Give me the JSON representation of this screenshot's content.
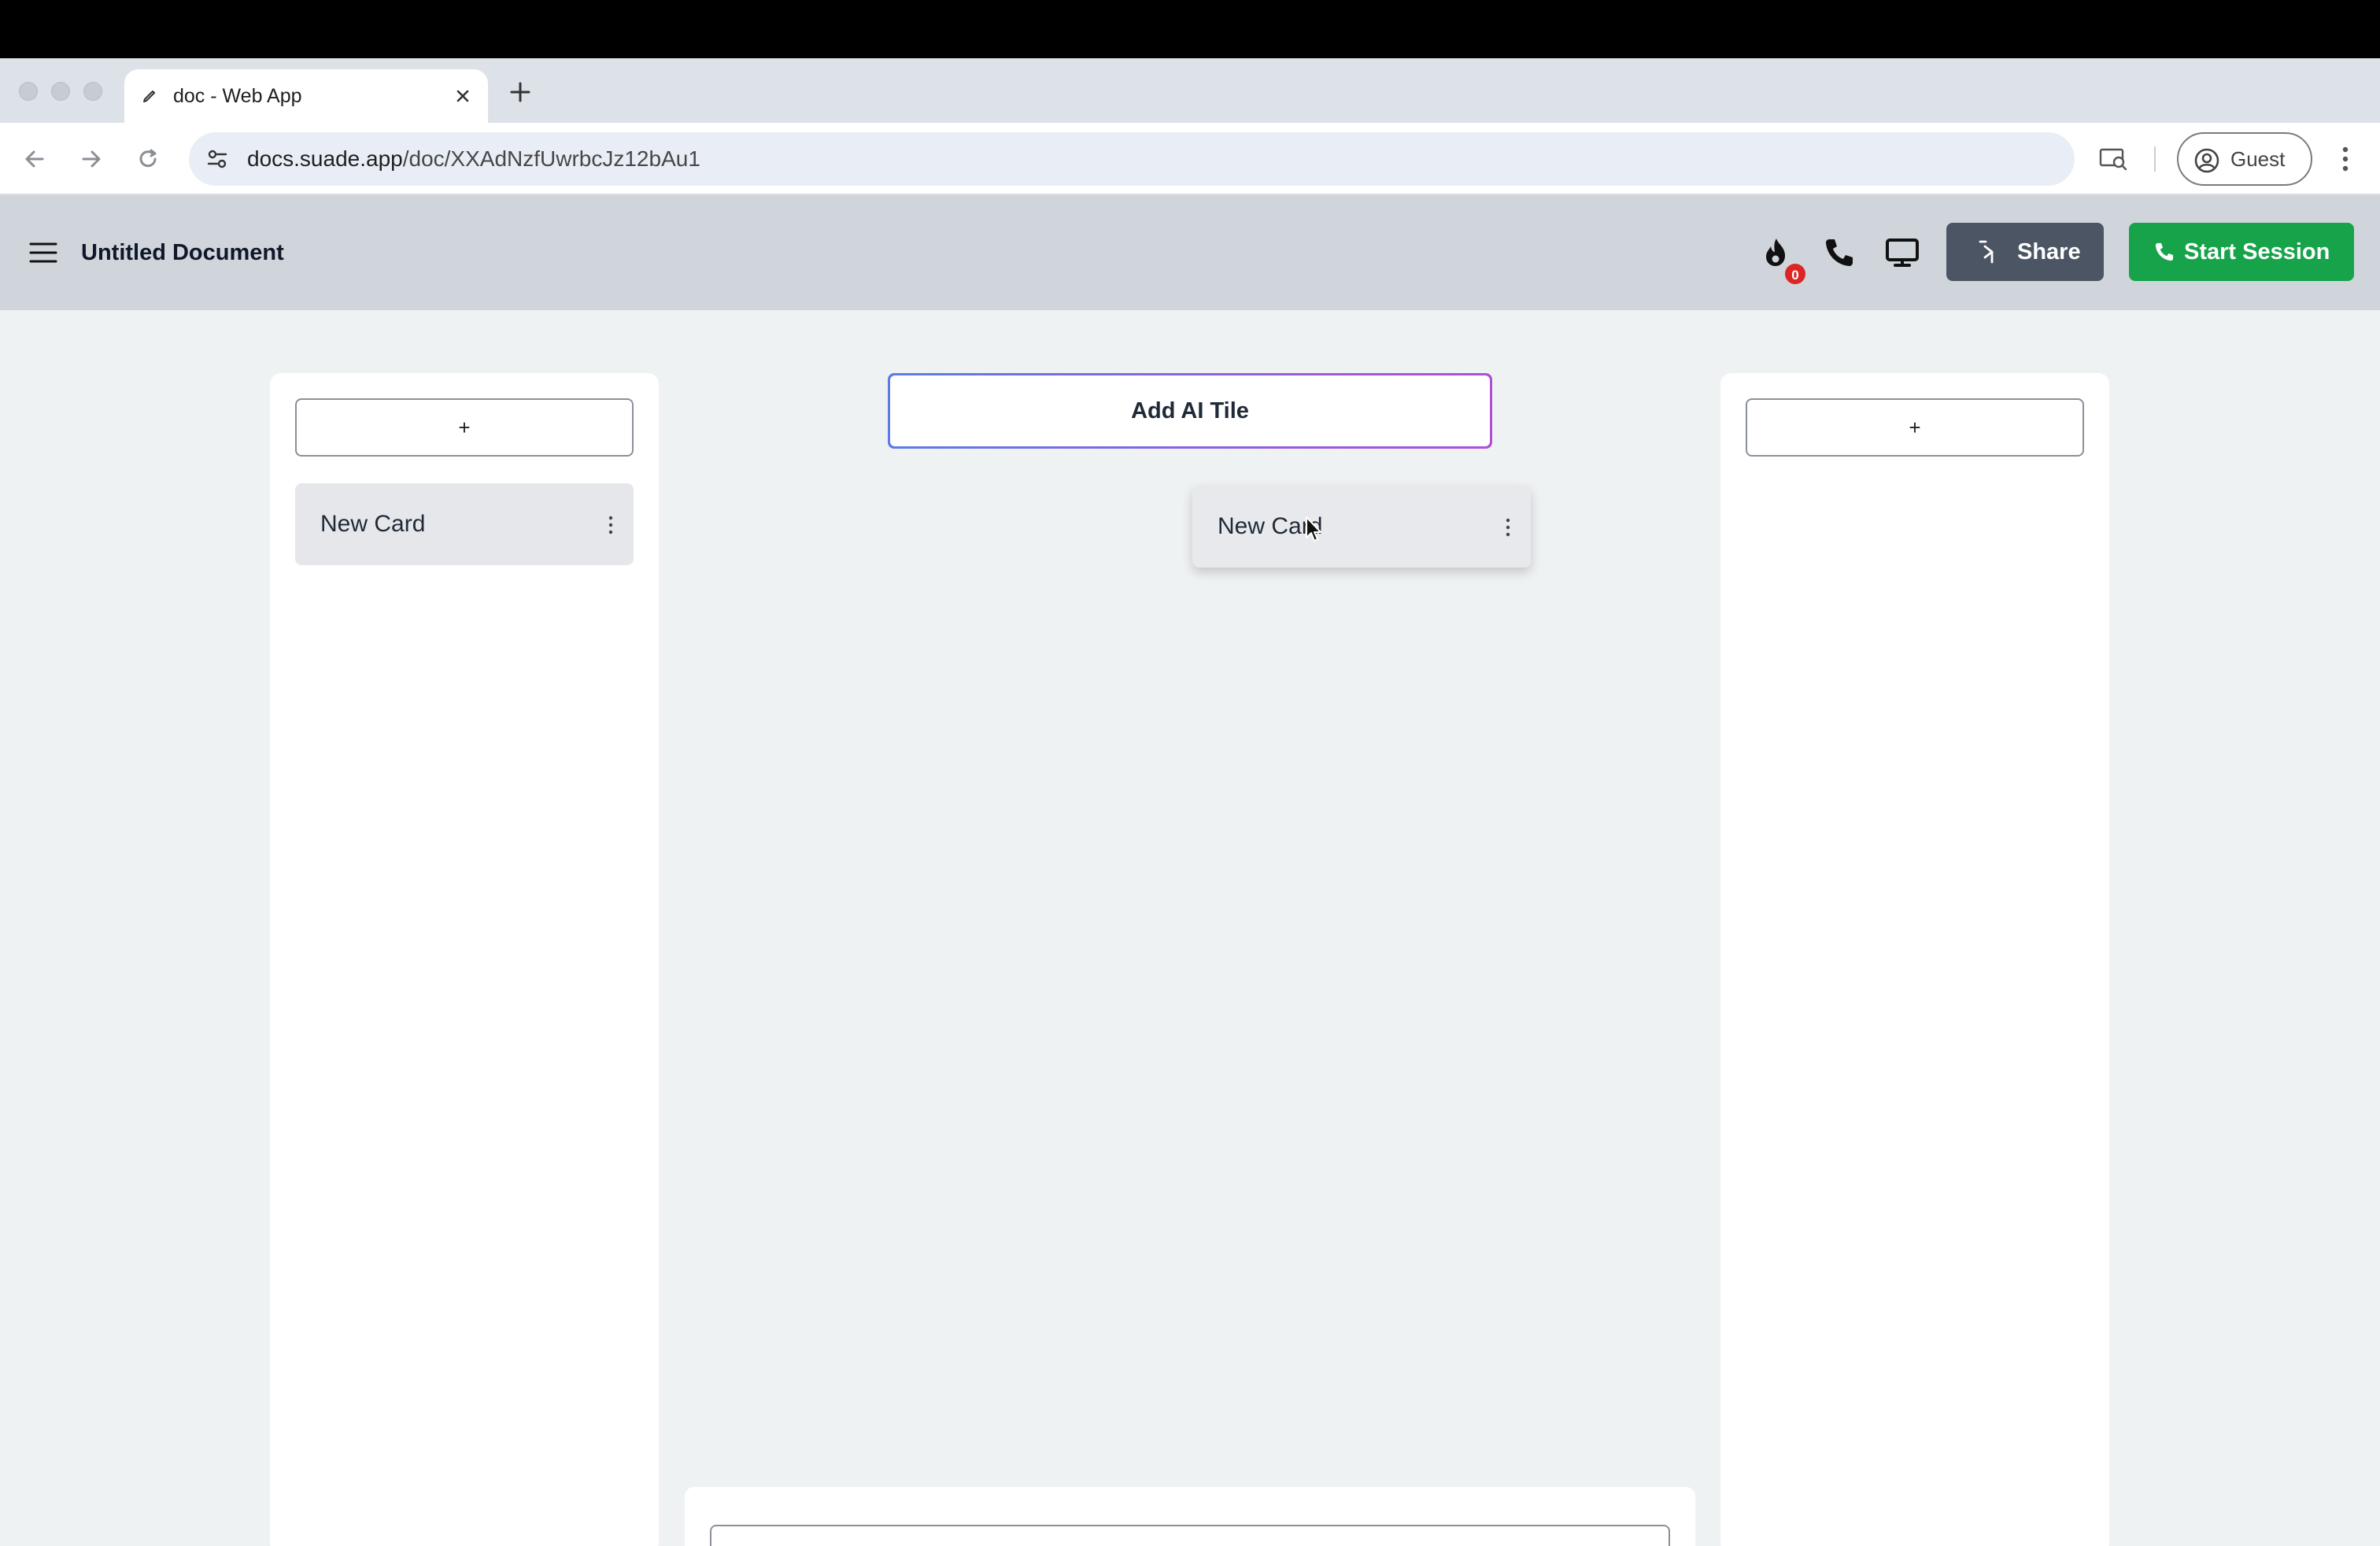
{
  "browser": {
    "tab": {
      "title": "doc - Web App",
      "favicon": "pen-icon"
    },
    "address": {
      "host": "docs.suade.app",
      "path": "/doc/XXAdNzfUwrbcJz12bAu1"
    },
    "profile_label": "Guest"
  },
  "header": {
    "title": "Untitled Document",
    "streak_badge": "0",
    "share_label": "Share",
    "start_session_label": "Start Session"
  },
  "board": {
    "left_column": {
      "add_label": "+",
      "cards": [
        {
          "title": "New Card"
        }
      ]
    },
    "ai_tile_label": "Add AI Tile",
    "dragging_card": {
      "title": "New Card"
    },
    "right_column": {
      "add_label": "+"
    }
  },
  "colors": {
    "header_bg": "#d0d5dc",
    "share_bg": "#4b5563",
    "start_session_bg": "#16a34a",
    "badge_bg": "#dc2626",
    "board_bg": "#eff2f3"
  }
}
